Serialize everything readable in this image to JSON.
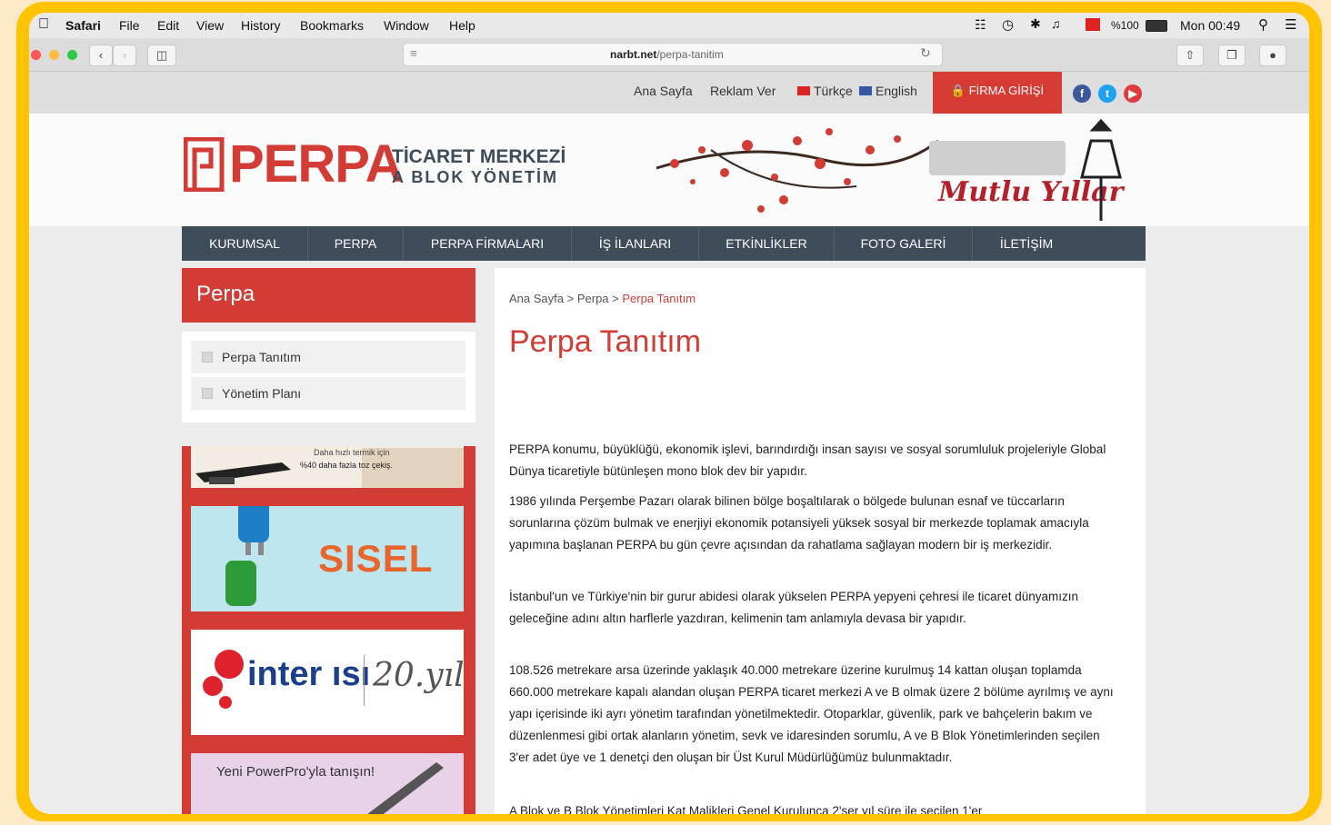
{
  "menubar": {
    "app": "Safari",
    "items": [
      "File",
      "Edit",
      "View",
      "History",
      "Bookmarks",
      "Window",
      "Help"
    ],
    "battery": "%100",
    "clock": "Mon 00:49"
  },
  "browser": {
    "url_domain": "narbt.net",
    "url_path": "/perpa-tanitim"
  },
  "topbar": {
    "home": "Ana Sayfa",
    "ads": "Reklam Ver",
    "lang_tr": "Türkçe",
    "lang_en": "English",
    "firma": "FİRMA GİRİŞİ"
  },
  "header": {
    "logo": "PERPA",
    "logo_line1": "TİCARET MERKEZİ",
    "logo_line2": "A BLOK YÖNETİM",
    "greeting": "Mutlu Yıllar"
  },
  "nav": [
    "KURUMSAL",
    "PERPA",
    "PERPA FİRMALARI",
    "İŞ İLANLARI",
    "ETKİNLİKLER",
    "FOTO GALERİ",
    "İLETİŞİM"
  ],
  "sidebar": {
    "heading": "Perpa",
    "items": [
      "Perpa Tanıtım",
      "Yönetim Planı"
    ]
  },
  "ads": {
    "ad1_line1": "Daha hızlı termik için",
    "ad1_line2": "%40 daha fazla toz çekiş.",
    "ad2": "SISEL",
    "ad3_brand": "inter ısı",
    "ad3_year": "20.yıl",
    "ad4": "Yeni PowerPro'yla tanışın!"
  },
  "content": {
    "breadcrumb_home": "Ana Sayfa",
    "breadcrumb_mid": "Perpa",
    "breadcrumb_current": "Perpa Tanıtım",
    "title": "Perpa Tanıtım",
    "paragraphs": [
      "PERPA konumu, büyüklüğü, ekonomik işlevi, barındırdığı insan sayısı ve sosyal sorumluluk projeleriyle Global Dünya ticaretiyle bütünleşen mono blok dev bir yapıdır.",
      "1986 yılında Perşembe Pazarı olarak bilinen bölge boşaltılarak o bölgede bulunan esnaf ve tüccarların sorunlarına çözüm bulmak ve enerjiyi ekonomik potansiyeli yüksek sosyal bir merkezde toplamak amacıyla yapımına başlanan PERPA bu gün çevre açısından da rahatlama sağlayan modern bir iş merkezidir.",
      "İstanbul'un ve Türkiye'nin bir gurur abidesi olarak yükselen PERPA yepyeni çehresi ile ticaret dünyamızın geleceğine adını altın harflerle yazdıran, kelimenin tam anlamıyla devasa bir yapıdır.",
      "108.526 metrekare arsa üzerinde yaklaşık 40.000 metrekare üzerine kurulmuş 14 kattan oluşan toplamda 660.000 metrekare kapalı alandan oluşan PERPA ticaret merkezi A ve B olmak üzere 2 bölüme ayrılmış ve aynı yapı içerisinde iki ayrı yönetim tarafından yönetilmektedir. Otoparklar, güvenlik, park ve bahçelerin bakım ve düzenlenmesi gibi ortak alanların yönetim, sevk ve idaresinden sorumlu, A ve B Blok Yönetimlerinden seçilen 3'er adet üye ve 1 denetçi den oluşan bir Üst Kurul Müdürlüğümüz bulunmaktadır.",
      "A Blok ve B Blok Yönetimleri Kat Malikleri Genel Kurulunca 2'şer yıl süre ile seçilen 1'er"
    ]
  },
  "colors": {
    "accent": "#d33b35",
    "nav": "#3f4d5b",
    "frame": "#ffc400"
  }
}
